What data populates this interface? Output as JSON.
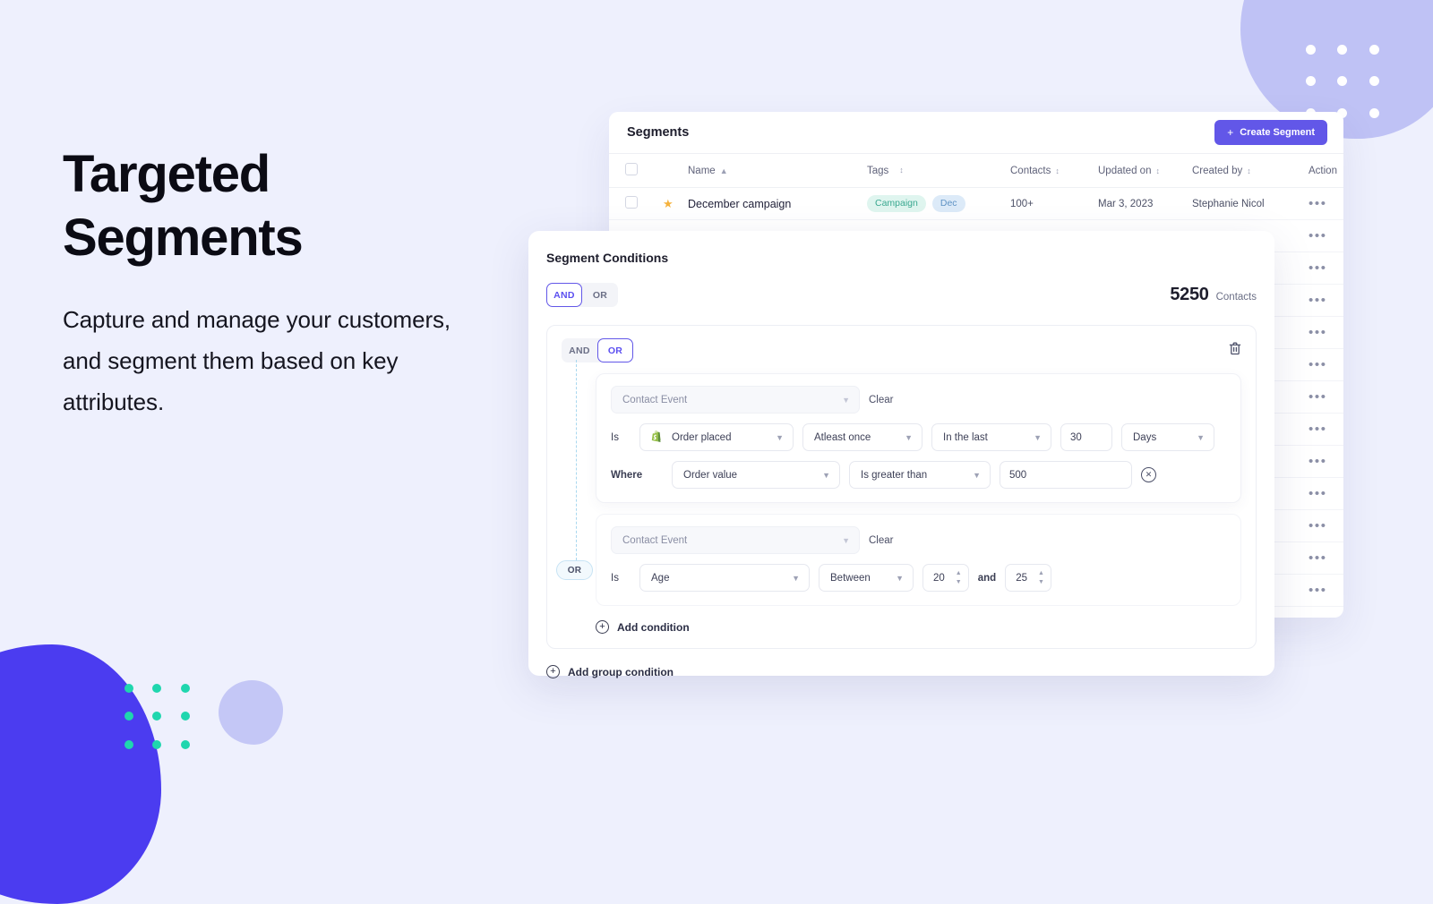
{
  "hero": {
    "title": "Targeted Segments",
    "subtitle": "Capture and manage your customers, and segment them based on key attributes."
  },
  "colors": {
    "background": "#eef0fd",
    "accent": "#6257e8",
    "accent_blob": "#4b3cf0",
    "lavender": "#bfc2f5",
    "teal_dot": "#1fd6ae",
    "connector": "#a9d8ef"
  },
  "segments_card": {
    "title": "Segments",
    "create_button": {
      "label": "Create Segment",
      "icon": "plus-icon"
    },
    "columns": [
      {
        "label": "Name",
        "sort": "asc"
      },
      {
        "label": "Tags",
        "sort": "both"
      },
      {
        "label": "Contacts",
        "sort": "both"
      },
      {
        "label": "Updated on",
        "sort": "both"
      },
      {
        "label": "Created by",
        "sort": "both"
      },
      {
        "label": "Action",
        "sort": "none"
      }
    ],
    "rows": [
      {
        "starred": true,
        "name": "December campaign",
        "tags": [
          "Campaign",
          "Dec"
        ],
        "contacts": "100+",
        "updated_on": "Mar 3, 2023",
        "created_by": "Stephanie Nicol",
        "action": "•••"
      }
    ],
    "extra_row_count": 13,
    "action_glyph": "•••"
  },
  "conditions_panel": {
    "title": "Segment Conditions",
    "root_operator": {
      "options": [
        "AND",
        "OR"
      ],
      "selected": "AND"
    },
    "contacts": {
      "count": "5250",
      "label": "Contacts"
    },
    "group": {
      "operator": {
        "options": [
          "AND",
          "OR"
        ],
        "selected": "OR"
      },
      "delete_icon": "trash-icon",
      "connector_badge": "OR",
      "conditions": [
        {
          "source": {
            "value": "Contact Event",
            "disabled": true
          },
          "clear_label": "Clear",
          "is_label": "Is",
          "event": {
            "value": "Order placed",
            "icon": "shopify-icon"
          },
          "frequency": "Atleast once",
          "timeframe": "In the last",
          "amount": "30",
          "unit": "Days",
          "where_label": "Where",
          "where_field": "Order value",
          "where_operator": "Is greater than",
          "where_value": "500",
          "remove_icon": "circle-x-icon"
        },
        {
          "source": {
            "value": "Contact Event",
            "disabled": true
          },
          "clear_label": "Clear",
          "is_label": "Is",
          "attribute": "Age",
          "operator": "Between",
          "value_from": "20",
          "and_label": "and",
          "value_to": "25"
        }
      ],
      "add_condition_label": "Add condition"
    },
    "add_group_condition_label": "Add group condition"
  }
}
